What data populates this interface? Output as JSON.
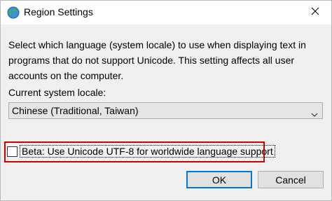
{
  "window": {
    "title": "Region Settings",
    "icon": "globe-icon",
    "close_icon": "close-icon"
  },
  "content": {
    "description_line1": "Select which language (system locale) to use when displaying text in",
    "description_line2": "programs that do not support Unicode. This setting affects all user",
    "description_line3": "accounts on the computer.",
    "locale_label": "Current system locale:",
    "locale_value": "Chinese (Traditional, Taiwan)",
    "beta_label": "Beta: Use Unicode UTF-8 for worldwide language support",
    "beta_checked": false
  },
  "buttons": {
    "ok": "OK",
    "cancel": "Cancel"
  },
  "colors": {
    "highlight_outline": "#cc0000",
    "default_button_border": "#0078d7",
    "dialog_background": "#f0f0f0"
  }
}
